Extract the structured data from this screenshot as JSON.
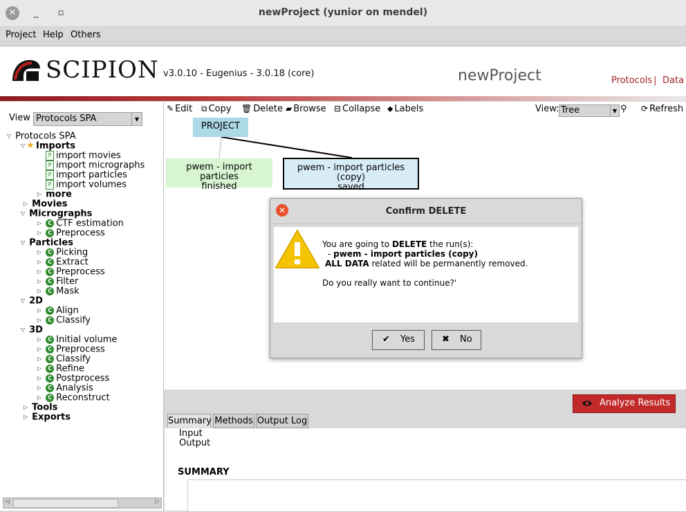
{
  "window": {
    "title": "newProject (yunior on mendel)"
  },
  "menu": {
    "items": [
      "Project",
      "Help",
      "Others"
    ]
  },
  "header": {
    "logo_text": "SCIPION",
    "version": "v3.0.10 - Eugenius - 3.0.18 (core)",
    "project_name": "newProject",
    "nav_protocols": "Protocols",
    "nav_separator": "|",
    "nav_data": "Data"
  },
  "sidebar": {
    "view_label": "View",
    "view_value": "Protocols SPA",
    "tree": {
      "root": "Protocols SPA",
      "imports": "Imports",
      "import_items": [
        "import movies",
        "import micrographs",
        "import particles",
        "import volumes"
      ],
      "more": "more",
      "movies": "Movies",
      "micrographs": "Micrographs",
      "micrograph_items": [
        "CTF estimation",
        "Preprocess"
      ],
      "particles": "Particles",
      "particle_items": [
        "Picking",
        "Extract",
        "Preprocess",
        "Filter",
        "Mask"
      ],
      "twod": "2D",
      "twod_items": [
        "Align",
        "Classify"
      ],
      "threed": "3D",
      "threed_items": [
        "Initial volume",
        "Preprocess",
        "Classify",
        "Refine",
        "Postprocess",
        "Analysis",
        "Reconstruct"
      ],
      "tools": "Tools",
      "exports": "Exports"
    }
  },
  "toolbar": {
    "edit": "Edit",
    "copy": "Copy",
    "delete": "Delete",
    "browse": "Browse",
    "collapse": "Collapse",
    "labels": "Labels",
    "view_label": "View:",
    "view_value": "Tree",
    "refresh": "Refresh"
  },
  "graph": {
    "project_node": "PROJECT",
    "node1_line1": "pwem - import particles",
    "node1_line2": "finished",
    "node2_line1": "pwem - import particles (copy)",
    "node2_line2": "saved",
    "colors": {
      "finished": "#d6f5d0",
      "saved": "#d8ecf7",
      "project": "#add8e6"
    }
  },
  "results": {
    "analyze_button": "Analyze Results",
    "tabs": [
      "Summary",
      "Methods",
      "Output Log"
    ],
    "input_label": "Input",
    "output_label": "Output",
    "summary_heading": "SUMMARY"
  },
  "dialog": {
    "title": "Confirm DELETE",
    "line1_prefix": "You are going to",
    "line1_bold": "DELETE",
    "line1_suffix": "the run(s):",
    "line2_dash": "-",
    "line2_bold": "pwem - import particles (copy)",
    "line3_bold": "ALL DATA",
    "line3_suffix": "related will be permanently removed.",
    "question": "Do you really want to continue?'",
    "yes": "Yes",
    "no": "No"
  }
}
